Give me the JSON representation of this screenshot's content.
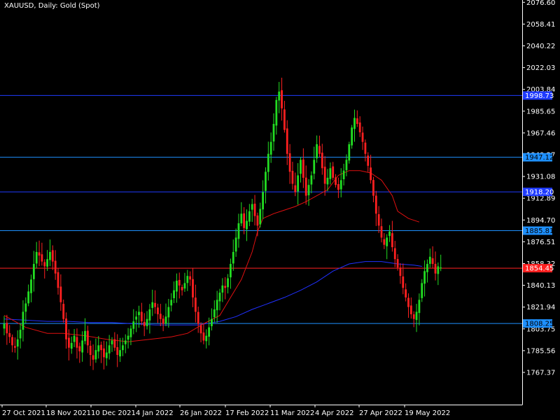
{
  "chart_data": {
    "type": "candlestick",
    "title": "XAUUSD, Daily:  Gold (Spot)",
    "y_ticks": [
      "2076.60",
      "2058.41",
      "2040.22",
      "2022.03",
      "2003.84",
      "1985.65",
      "1967.46",
      "1949.27",
      "1931.08",
      "1912.89",
      "1894.70",
      "1876.51",
      "1858.32",
      "1840.13",
      "1821.94",
      "1803.75",
      "1785.56",
      "1767.37"
    ],
    "x_labels": [
      "27 Oct 2021",
      "18 Nov 2021",
      "10 Dec 2021",
      "4 Jan 2022",
      "26 Jan 2022",
      "17 Feb 2022",
      "11 Mar 2022",
      "4 Apr 2022",
      "27 Apr 2022",
      "19 May 2022"
    ],
    "horizontal_lines": [
      {
        "label": "1998.73",
        "value": 1998.73,
        "line_color": "#1f3bff",
        "tag_bg": "#1f3bff",
        "tag_fg": "#ffffff"
      },
      {
        "label": "1947.12",
        "value": 1947.12,
        "line_color": "#1e90ff",
        "tag_bg": "#1e90ff",
        "tag_fg": "#000000"
      },
      {
        "label": "1918.20",
        "value": 1918.2,
        "line_color": "#1f3bff",
        "tag_bg": "#1f3bff",
        "tag_fg": "#ffffff"
      },
      {
        "label": "1885.81",
        "value": 1885.81,
        "line_color": "#1e90ff",
        "tag_bg": "#1e90ff",
        "tag_fg": "#000000"
      },
      {
        "label": "1854.45",
        "value": 1854.45,
        "line_color": "#ff2020",
        "tag_bg": "#ff2020",
        "tag_fg": "#ffffff"
      },
      {
        "label": "1808.25",
        "value": 1808.25,
        "line_color": "#1e90ff",
        "tag_bg": "#1e90ff",
        "tag_fg": "#000000"
      }
    ],
    "close": [
      1808,
      1800,
      1797,
      1790,
      1788,
      1795,
      1803,
      1818,
      1825,
      1835,
      1845,
      1858,
      1868,
      1865,
      1860,
      1856,
      1862,
      1868,
      1860,
      1850,
      1838,
      1826,
      1812,
      1795,
      1788,
      1792,
      1798,
      1788,
      1785,
      1794,
      1802,
      1790,
      1782,
      1778,
      1786,
      1790,
      1786,
      1780,
      1784,
      1790,
      1794,
      1788,
      1782,
      1786,
      1790,
      1794,
      1798,
      1804,
      1810,
      1814,
      1818,
      1810,
      1806,
      1812,
      1820,
      1826,
      1822,
      1816,
      1812,
      1808,
      1814,
      1822,
      1828,
      1836,
      1844,
      1840,
      1836,
      1842,
      1848,
      1845,
      1830,
      1818,
      1808,
      1800,
      1794,
      1798,
      1805,
      1812,
      1820,
      1828,
      1834,
      1840,
      1838,
      1846,
      1858,
      1868,
      1880,
      1892,
      1900,
      1888,
      1894,
      1902,
      1908,
      1898,
      1890,
      1904,
      1918,
      1935,
      1950,
      1960,
      1975,
      1995,
      2002,
      1988,
      1970,
      1950,
      1935,
      1925,
      1918,
      1932,
      1945,
      1930,
      1915,
      1924,
      1932,
      1945,
      1958,
      1950,
      1938,
      1925,
      1930,
      1938,
      1930,
      1924,
      1920,
      1928,
      1936,
      1945,
      1958,
      1972,
      1980,
      1975,
      1968,
      1960,
      1950,
      1940,
      1928,
      1915,
      1900,
      1890,
      1880,
      1874,
      1880,
      1885,
      1872,
      1862,
      1855,
      1848,
      1838,
      1830,
      1822,
      1816,
      1812,
      1818,
      1828,
      1842,
      1852,
      1858,
      1864,
      1858,
      1850,
      1856,
      1855
    ],
    "ma_red": [
      [
        0,
        1815
      ],
      [
        8,
        1805
      ],
      [
        16,
        1800
      ],
      [
        22,
        1800
      ],
      [
        30,
        1798
      ],
      [
        38,
        1795
      ],
      [
        46,
        1793
      ],
      [
        54,
        1795
      ],
      [
        62,
        1797
      ],
      [
        68,
        1800
      ],
      [
        74,
        1808
      ],
      [
        80,
        1815
      ],
      [
        84,
        1830
      ],
      [
        88,
        1845
      ],
      [
        92,
        1868
      ],
      [
        94,
        1885
      ],
      [
        96,
        1896
      ],
      [
        100,
        1900
      ],
      [
        104,
        1903
      ],
      [
        108,
        1906
      ],
      [
        112,
        1910
      ],
      [
        116,
        1915
      ],
      [
        120,
        1920
      ],
      [
        124,
        1932
      ],
      [
        128,
        1936
      ],
      [
        132,
        1936
      ],
      [
        136,
        1934
      ],
      [
        140,
        1928
      ],
      [
        144,
        1915
      ],
      [
        146,
        1902
      ],
      [
        150,
        1896
      ],
      [
        154,
        1893
      ]
    ],
    "ma_blue": [
      [
        0,
        1812
      ],
      [
        8,
        1811
      ],
      [
        16,
        1810
      ],
      [
        24,
        1810
      ],
      [
        32,
        1809
      ],
      [
        40,
        1809
      ],
      [
        48,
        1808
      ],
      [
        56,
        1807
      ],
      [
        64,
        1807
      ],
      [
        72,
        1807
      ],
      [
        80,
        1810
      ],
      [
        86,
        1814
      ],
      [
        92,
        1820
      ],
      [
        98,
        1825
      ],
      [
        104,
        1830
      ],
      [
        110,
        1836
      ],
      [
        116,
        1843
      ],
      [
        122,
        1852
      ],
      [
        128,
        1858
      ],
      [
        134,
        1860
      ],
      [
        140,
        1860
      ],
      [
        146,
        1858
      ],
      [
        152,
        1857
      ],
      [
        155,
        1856
      ]
    ],
    "ymin": 1758.28,
    "ymax": 2076.6
  }
}
